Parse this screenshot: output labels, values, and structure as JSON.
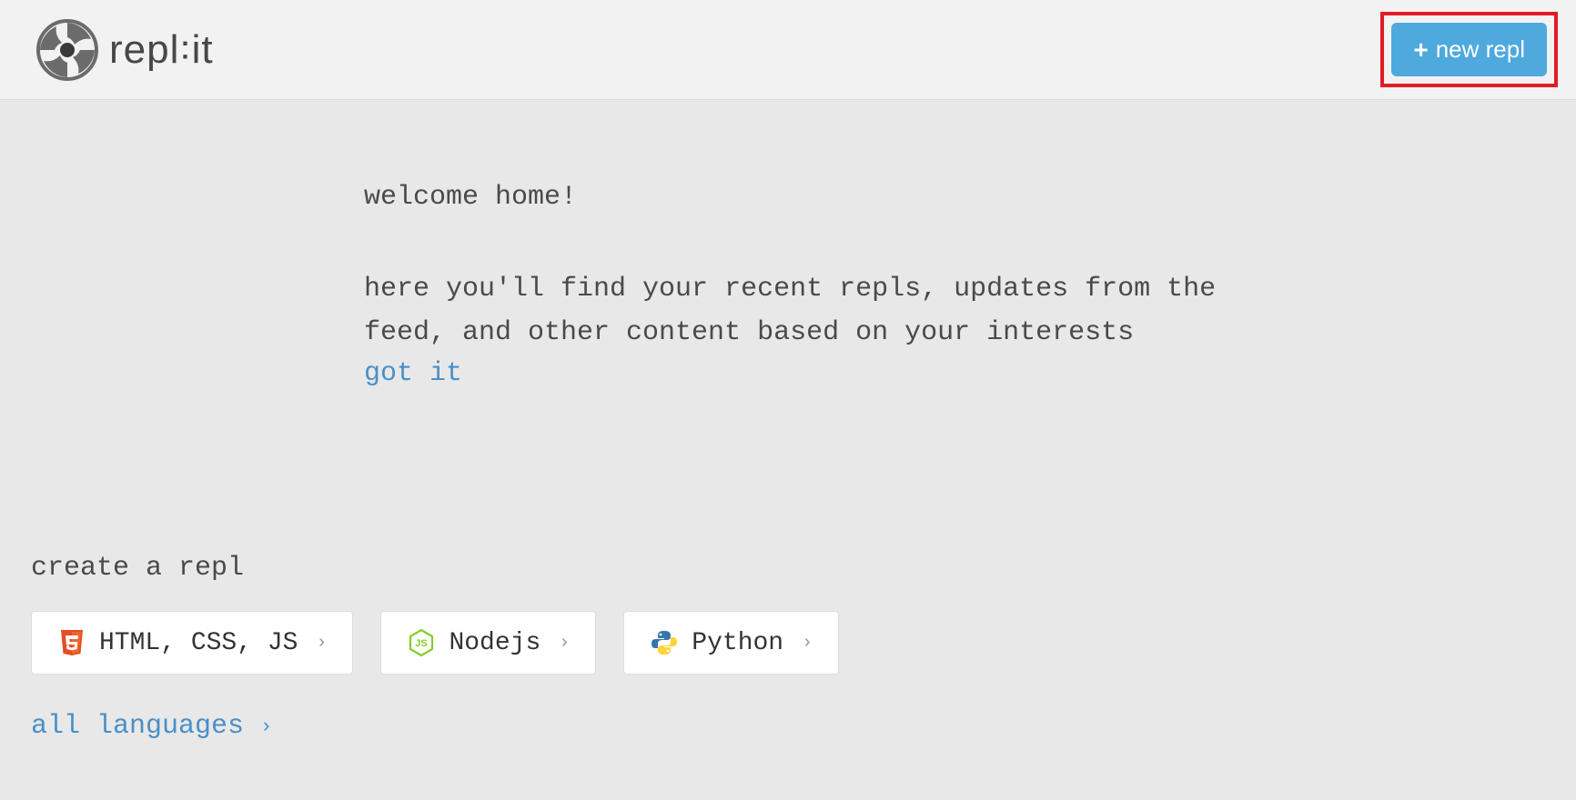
{
  "header": {
    "logo_text": "repl꞉it",
    "new_repl_label": "new repl"
  },
  "welcome": {
    "title": "welcome home!",
    "description": "here you'll find your recent repls, updates from the feed, and other content based on your interests",
    "dismiss_label": "got it"
  },
  "create": {
    "heading": "create a repl",
    "languages": [
      {
        "name": "HTML, CSS, JS",
        "icon": "html5-icon"
      },
      {
        "name": "Nodejs",
        "icon": "nodejs-icon"
      },
      {
        "name": "Python",
        "icon": "python-icon"
      }
    ],
    "all_languages_label": "all languages"
  },
  "colors": {
    "accent_blue": "#4ea9dd",
    "link_blue": "#4a8fc7",
    "highlight_red": "#e31b23"
  }
}
